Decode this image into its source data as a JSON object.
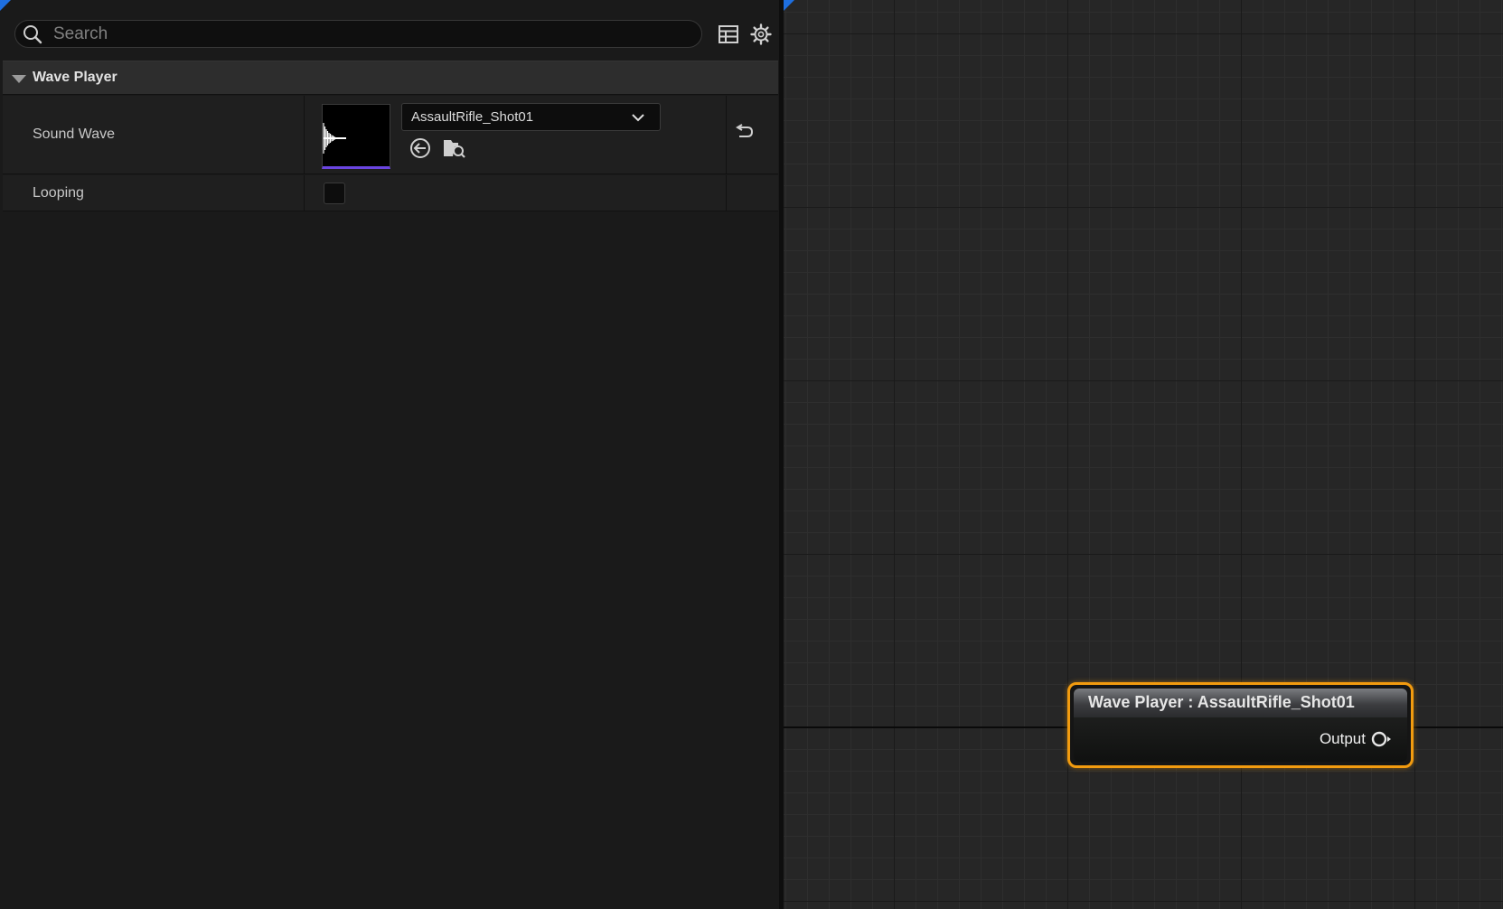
{
  "details": {
    "search": {
      "placeholder": "Search",
      "value": ""
    },
    "toolbar": {
      "table_view_icon": "table-icon",
      "settings_icon": "gear-icon"
    },
    "category": {
      "title": "Wave Player",
      "expanded": true
    },
    "properties": [
      {
        "name": "Sound Wave",
        "value": "AssaultRifle_Shot01",
        "thumbnail_icon": "sound-wave-thumbnail",
        "buttons": [
          "use-selected-asset-icon",
          "browse-to-asset-icon"
        ],
        "reset_icon": "reset-arrow-icon"
      },
      {
        "name": "Looping",
        "checked": false
      }
    ]
  },
  "graph": {
    "node": {
      "title": "Wave Player : AssaultRifle_Shot01",
      "output_label": "Output",
      "selected": true
    }
  },
  "colors": {
    "accent_blue": "#1e6fe0",
    "node_selection": "#f29b0f",
    "thumbnail_underline": "#6a45e0"
  }
}
